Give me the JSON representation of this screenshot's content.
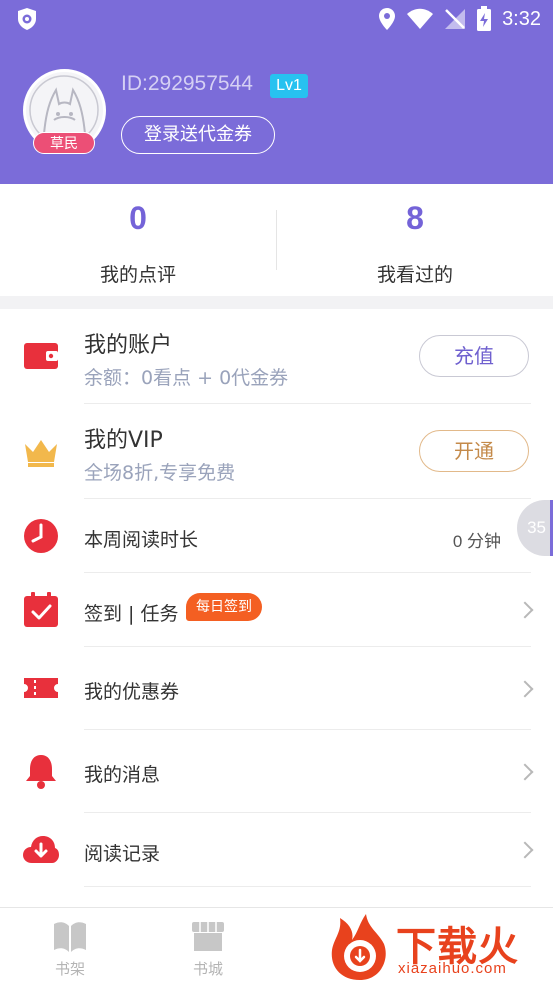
{
  "status_bar": {
    "time": "3:32"
  },
  "profile": {
    "user_id": "ID:292957544",
    "level": "Lv1",
    "rank": "草民",
    "login_button": "登录送代金券"
  },
  "stats": [
    {
      "value": "0",
      "label": "我的点评"
    },
    {
      "value": "8",
      "label": "我看过的"
    }
  ],
  "account": {
    "title": "我的账户",
    "subtitle": "余额：0看点 + 0代金券",
    "button": "充值"
  },
  "vip": {
    "title": "我的VIP",
    "subtitle": "全场8折,专享免费",
    "button": "开通"
  },
  "menu": [
    {
      "label": "本周阅读时长",
      "value": "0 分钟",
      "icon": "clock-icon"
    },
    {
      "label": "签到 | 任务",
      "tag": "每日签到",
      "icon": "calendar-check-icon"
    },
    {
      "label": "我的优惠券",
      "icon": "ticket-icon"
    },
    {
      "label": "我的消息",
      "icon": "bell-icon"
    },
    {
      "label": "阅读记录",
      "icon": "cloud-download-icon"
    }
  ],
  "float_tab": "35",
  "bottom_nav": [
    {
      "label": "书架",
      "icon": "book-icon"
    },
    {
      "label": "书城",
      "icon": "store-icon"
    }
  ],
  "watermark": {
    "title": "下载火",
    "url": "xiazaihuo.com"
  },
  "colors": {
    "header": "#7B6CD9",
    "accent": "#7463D8",
    "red": "#E8303C",
    "gold": "#F2B84C",
    "tag_orange": "#F45F22"
  }
}
